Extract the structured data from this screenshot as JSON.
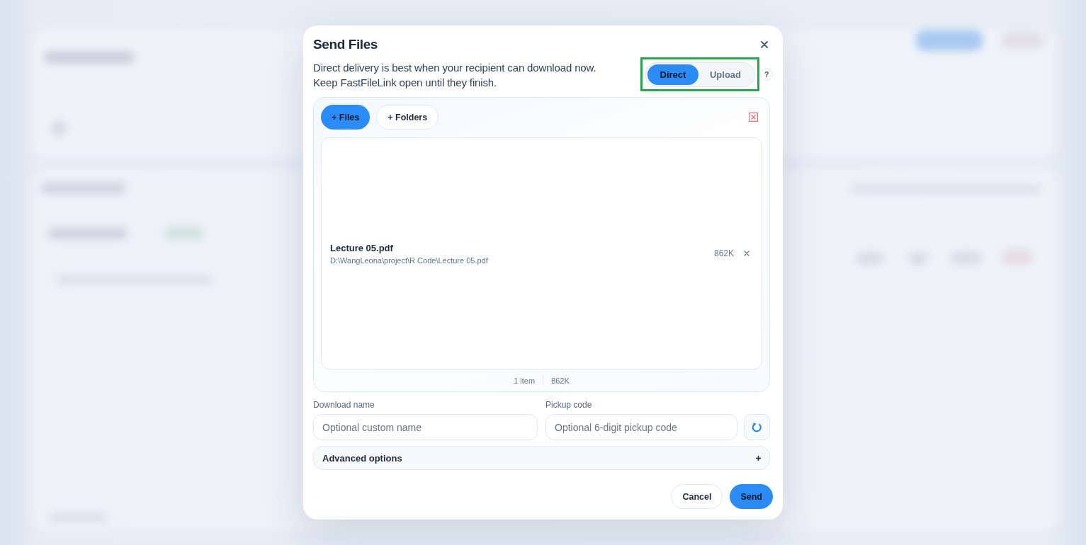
{
  "dialog": {
    "title": "Send Files",
    "description": [
      "Direct delivery is best when your recipient can download now.",
      "Keep FastFileLink open until they finish."
    ],
    "mode_toggle": {
      "highlighted": true,
      "options": [
        {
          "label": "Direct",
          "selected": true
        },
        {
          "label": "Upload",
          "selected": false
        }
      ]
    },
    "help": "?"
  },
  "file_picker": {
    "add_buttons": [
      {
        "label": "+ Files",
        "kind": "primary"
      },
      {
        "label": "+ Folders",
        "kind": "secondary"
      }
    ],
    "files": [
      {
        "name": "Lecture 05.pdf",
        "path": "D:\\WangLeona\\project\\R Code\\Lecture 05.pdf",
        "size": "862K"
      }
    ],
    "summary": {
      "count": "1 item",
      "total": "862K"
    }
  },
  "fields": [
    {
      "label": "Download name",
      "placeholder": "Optional custom name",
      "kind": "text"
    },
    {
      "label": "Pickup code",
      "placeholder": "Optional 6-digit pickup code",
      "kind": "with_refresh"
    }
  ],
  "advanced": {
    "label": "Advanced options",
    "expanded": false
  },
  "actions": [
    {
      "label": "Cancel",
      "kind": "secondary"
    },
    {
      "label": "Send",
      "kind": "primary"
    }
  ]
}
